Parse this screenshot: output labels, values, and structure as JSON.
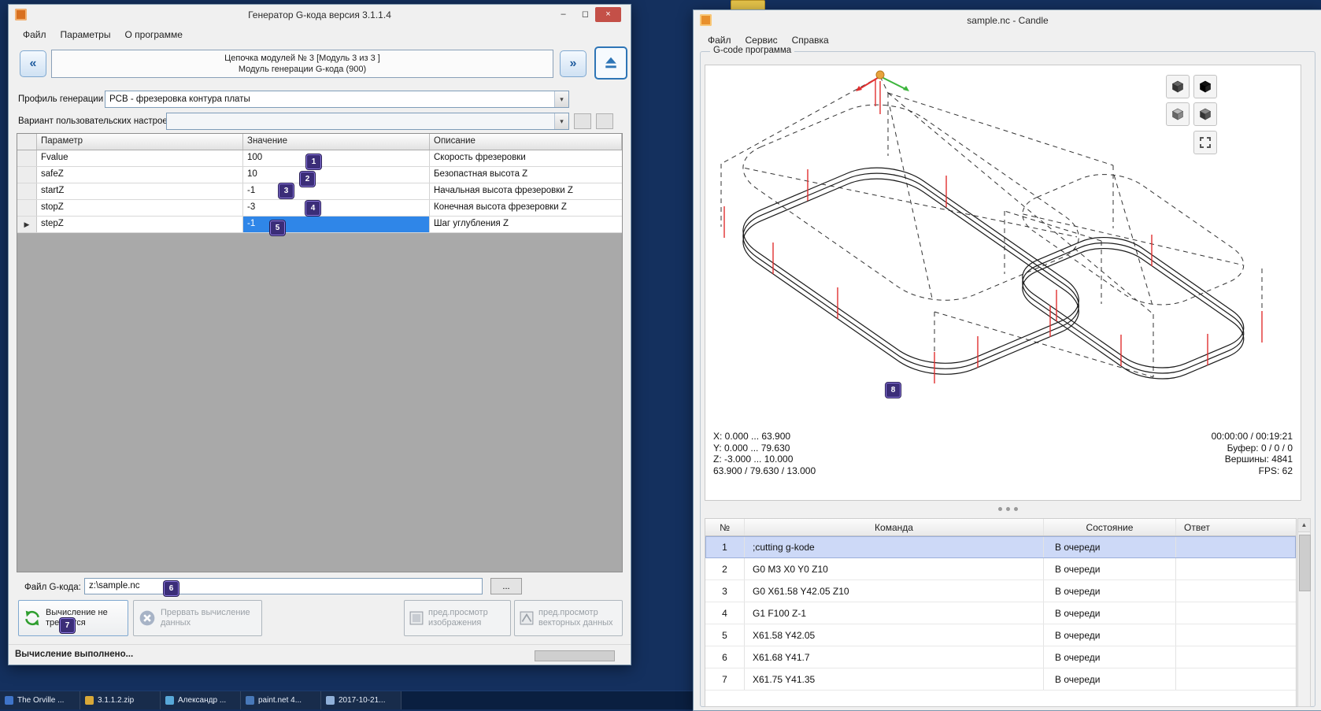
{
  "desktop": {
    "taskbar_items": [
      "The Orville ...",
      "3.1.1.2.zip",
      "Александр ...",
      "paint.net 4...",
      "2017-10-21..."
    ]
  },
  "icons": {
    "minimize": "–",
    "maximize": "◻",
    "close": "×",
    "nav_prev": "«",
    "nav_next": "»",
    "combo_arrow": "▾",
    "row_marker": "▶",
    "scroll_up": "▲"
  },
  "generator_window": {
    "title": "Генератор G-кода версия 3.1.1.4",
    "menu": [
      "Файл",
      "Параметры",
      "О программе"
    ],
    "nav": {
      "line1": "Цепочка модулей № 3 [Модуль 3 из 3 ]",
      "line2": "Модуль генерации G-кода (900)"
    },
    "profile_label": "Профиль генерации G-кода:",
    "profile_value": "PCB - фрезеровка контура платы",
    "settings_label": "Вариант пользовательских настроек:",
    "settings_value": "",
    "table": {
      "col_param": "Параметр",
      "col_value": "Значение",
      "col_desc": "Описание",
      "rows": [
        {
          "param": "Fvalue",
          "value": "100",
          "desc": "Скорость фрезеровки"
        },
        {
          "param": "safeZ",
          "value": "10",
          "desc": "Безопастная высота Z"
        },
        {
          "param": "startZ",
          "value": "-1",
          "desc": "Начальная высота фрезеровки Z"
        },
        {
          "param": "stopZ",
          "value": "-3",
          "desc": "Конечная высота фрезеровки Z"
        },
        {
          "param": "stepZ",
          "value": "-1",
          "desc": "Шаг углубления Z"
        }
      ]
    },
    "file_label": "Файл G-кода:",
    "file_value": "z:\\sample.nc",
    "browse_label": "...",
    "btn_compute": "Вычисление не требуется",
    "btn_abort": "Прервать вычисление данных",
    "btn_preview_image": "пред.просмотр изображения",
    "btn_preview_vector": "пред.просмотр векторных данных",
    "status": "Вычисление выполнено..."
  },
  "candle_window": {
    "title": "sample.nc - Candle",
    "menu": [
      "Файл",
      "Сервис",
      "Справка"
    ],
    "group_title": "G-code программа",
    "stats_left": [
      "X: 0.000 ... 63.900",
      "Y: 0.000 ... 79.630",
      "Z: -3.000 ... 10.000",
      "63.900 / 79.630 / 13.000"
    ],
    "stats_right": [
      "00:00:00 / 00:19:21",
      "Буфер: 0 / 0 / 0",
      "Вершины: 4841",
      "FPS: 62"
    ],
    "table": {
      "col_n": "№",
      "col_cmd": "Команда",
      "col_state": "Состояние",
      "col_resp": "Ответ",
      "rows": [
        {
          "n": "1",
          "cmd": ";cutting g-kode",
          "state": "В очереди",
          "resp": ""
        },
        {
          "n": "2",
          "cmd": "G0 M3 X0 Y0 Z10",
          "state": "В очереди",
          "resp": ""
        },
        {
          "n": "3",
          "cmd": "G0 X61.58 Y42.05 Z10",
          "state": "В очереди",
          "resp": ""
        },
        {
          "n": "4",
          "cmd": "G1 F100 Z-1",
          "state": "В очереди",
          "resp": ""
        },
        {
          "n": "5",
          "cmd": "X61.58 Y42.05",
          "state": "В очереди",
          "resp": ""
        },
        {
          "n": "6",
          "cmd": "X61.68 Y41.7",
          "state": "В очереди",
          "resp": ""
        },
        {
          "n": "7",
          "cmd": "X61.75 Y41.35",
          "state": "В очереди",
          "resp": ""
        }
      ]
    }
  },
  "annotations": [
    "1",
    "2",
    "3",
    "4",
    "5",
    "6",
    "7",
    "8"
  ]
}
